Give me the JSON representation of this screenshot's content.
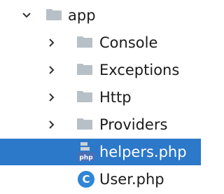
{
  "tree": {
    "root": {
      "label": "app",
      "expanded": true,
      "icon": "folder-icon"
    },
    "folders": [
      {
        "label": "Console",
        "expanded": false,
        "icon": "folder-icon"
      },
      {
        "label": "Exceptions",
        "expanded": false,
        "icon": "folder-icon"
      },
      {
        "label": "Http",
        "expanded": false,
        "icon": "folder-icon"
      },
      {
        "label": "Providers",
        "expanded": false,
        "icon": "folder-icon"
      }
    ],
    "files": [
      {
        "label": "helpers.php",
        "selected": true,
        "icon": "php-file-icon",
        "badge": "php"
      },
      {
        "label": "User.php",
        "selected": false,
        "icon": "class-icon",
        "badge": "C"
      }
    ]
  },
  "colors": {
    "selection": "#2c78c9",
    "folder": "#b7c0c7",
    "class_icon": "#2f86d6",
    "text": "#1b1b1b"
  }
}
